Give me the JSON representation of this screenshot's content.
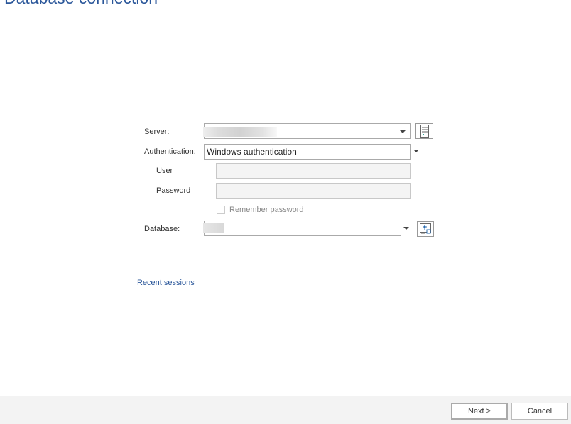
{
  "title": "Database connection",
  "form": {
    "server_label": "Server:",
    "auth_label": "Authentication:",
    "auth_value": "Windows authentication",
    "user_label": "User",
    "password_label": "Password",
    "remember_label": "Remember password",
    "remember_checked": false,
    "database_label": "Database:"
  },
  "recent_sessions": "Recent sessions",
  "footer": {
    "next": "Next >",
    "cancel": "Cancel"
  }
}
